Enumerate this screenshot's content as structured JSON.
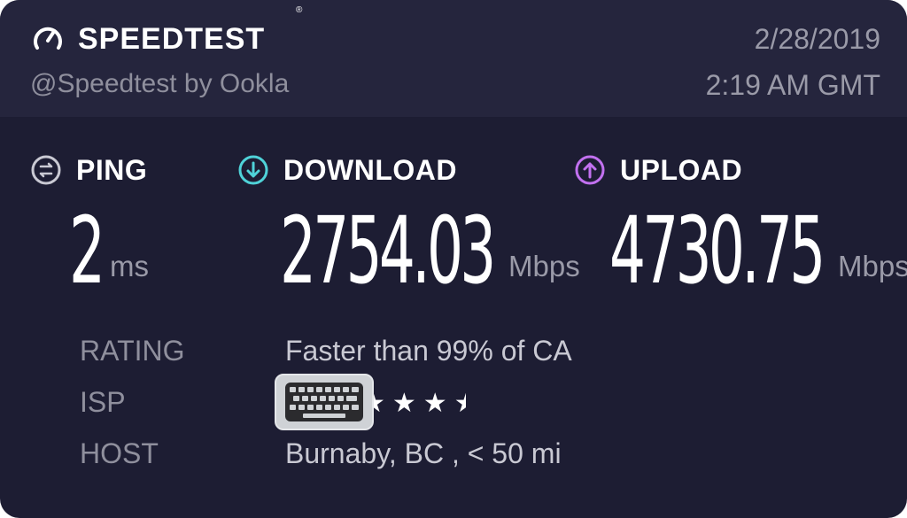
{
  "header": {
    "brand": "SPEEDTEST",
    "trademark": "®",
    "handle": "@Speedtest by Ookla",
    "date": "2/28/2019",
    "time": "2:19 AM GMT"
  },
  "metrics": {
    "ping": {
      "label": "PING",
      "value": "2",
      "unit": "ms",
      "icon": "ping-icon"
    },
    "download": {
      "label": "DOWNLOAD",
      "value": "2754.03",
      "unit": "Mbps",
      "icon": "download-icon",
      "color": "#4fd2d8"
    },
    "upload": {
      "label": "UPLOAD",
      "value": "4730.75",
      "unit": "Mbps",
      "icon": "upload-icon",
      "color": "#c271f0"
    }
  },
  "info": {
    "rating_label": "RATING",
    "rating_value": "Faster than 99% of CA",
    "isp_label": "ISP",
    "isp_stars": "★★★",
    "isp_rating": 3.5,
    "host_label": "HOST",
    "host_value": "Burnaby, BC , < 50 mi"
  }
}
